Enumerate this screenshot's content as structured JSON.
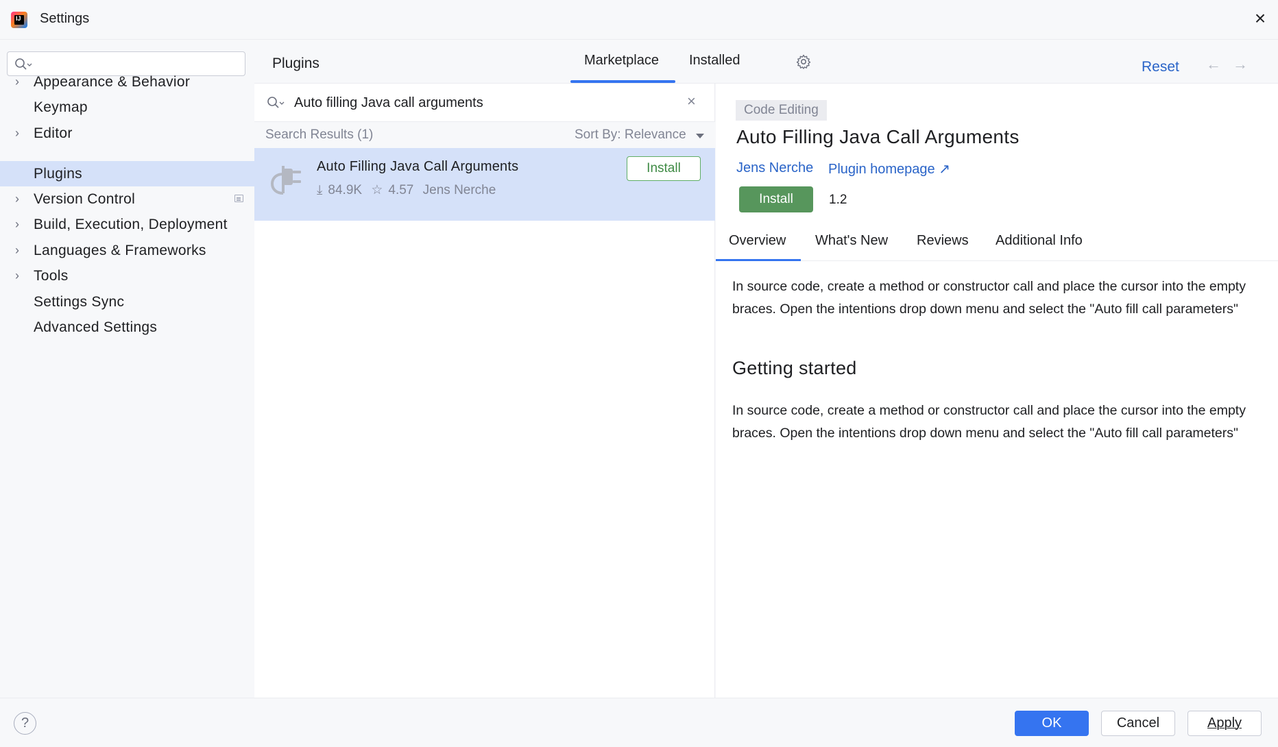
{
  "window": {
    "title": "Settings",
    "logo_text": "IJ",
    "close_glyph": "×"
  },
  "sidebar": {
    "search_placeholder": "",
    "items": [
      {
        "label": "Appearance & Behavior",
        "expandable": true
      },
      {
        "label": "Keymap",
        "expandable": false
      },
      {
        "label": "Editor",
        "expandable": true
      },
      {
        "label": "Plugins",
        "expandable": false,
        "selected": true
      },
      {
        "label": "Version Control",
        "expandable": true
      },
      {
        "label": "Build, Execution, Deployment",
        "expandable": true
      },
      {
        "label": "Languages & Frameworks",
        "expandable": true
      },
      {
        "label": "Tools",
        "expandable": true
      },
      {
        "label": "Settings Sync",
        "expandable": false
      },
      {
        "label": "Advanced Settings",
        "expandable": false
      }
    ],
    "chevron_glyph": "›"
  },
  "header": {
    "title": "Plugins",
    "tabs": [
      {
        "label": "Marketplace",
        "active": true
      },
      {
        "label": "Installed",
        "active": false
      }
    ],
    "reset_label": "Reset",
    "back_glyph": "←",
    "forward_glyph": "→"
  },
  "list": {
    "search_value": "Auto filling Java call arguments",
    "clear_glyph": "×",
    "results_count": "Search Results (1)",
    "sort_label": "Sort By: Relevance",
    "results": [
      {
        "name": "Auto Filling Java Call Arguments",
        "downloads": "84.9K",
        "rating": "4.57",
        "vendor": "Jens Nerche",
        "install_label": "Install",
        "download_glyph": "⤓",
        "star_glyph": "☆"
      }
    ]
  },
  "details": {
    "category": "Code Editing",
    "title": "Auto Filling Java Call Arguments",
    "vendor": "Jens Nerche",
    "homepage": "Plugin homepage ↗",
    "install_label": "Install",
    "version": "1.2",
    "tabs": [
      {
        "label": "Overview",
        "active": true
      },
      {
        "label": "What's New",
        "active": false
      },
      {
        "label": "Reviews",
        "active": false
      },
      {
        "label": "Additional Info",
        "active": false
      }
    ],
    "overview_text": "In source code, create a method or constructor call and place the cursor into the empty braces. Open the intentions drop down menu and select the \"Auto fill call parameters\"",
    "getting_started_heading": "Getting started",
    "getting_started_text": "In source code, create a method or constructor call and place the cursor into the empty braces. Open the intentions drop down menu and select the \"Auto fill call parameters\""
  },
  "footer": {
    "help_glyph": "?",
    "ok_label": "OK",
    "cancel_label": "Cancel",
    "apply_label": "Apply"
  },
  "colors": {
    "accent": "#3574f0",
    "selection": "#d5e1f9",
    "install_green": "#57965c",
    "link": "#2a64c8"
  }
}
